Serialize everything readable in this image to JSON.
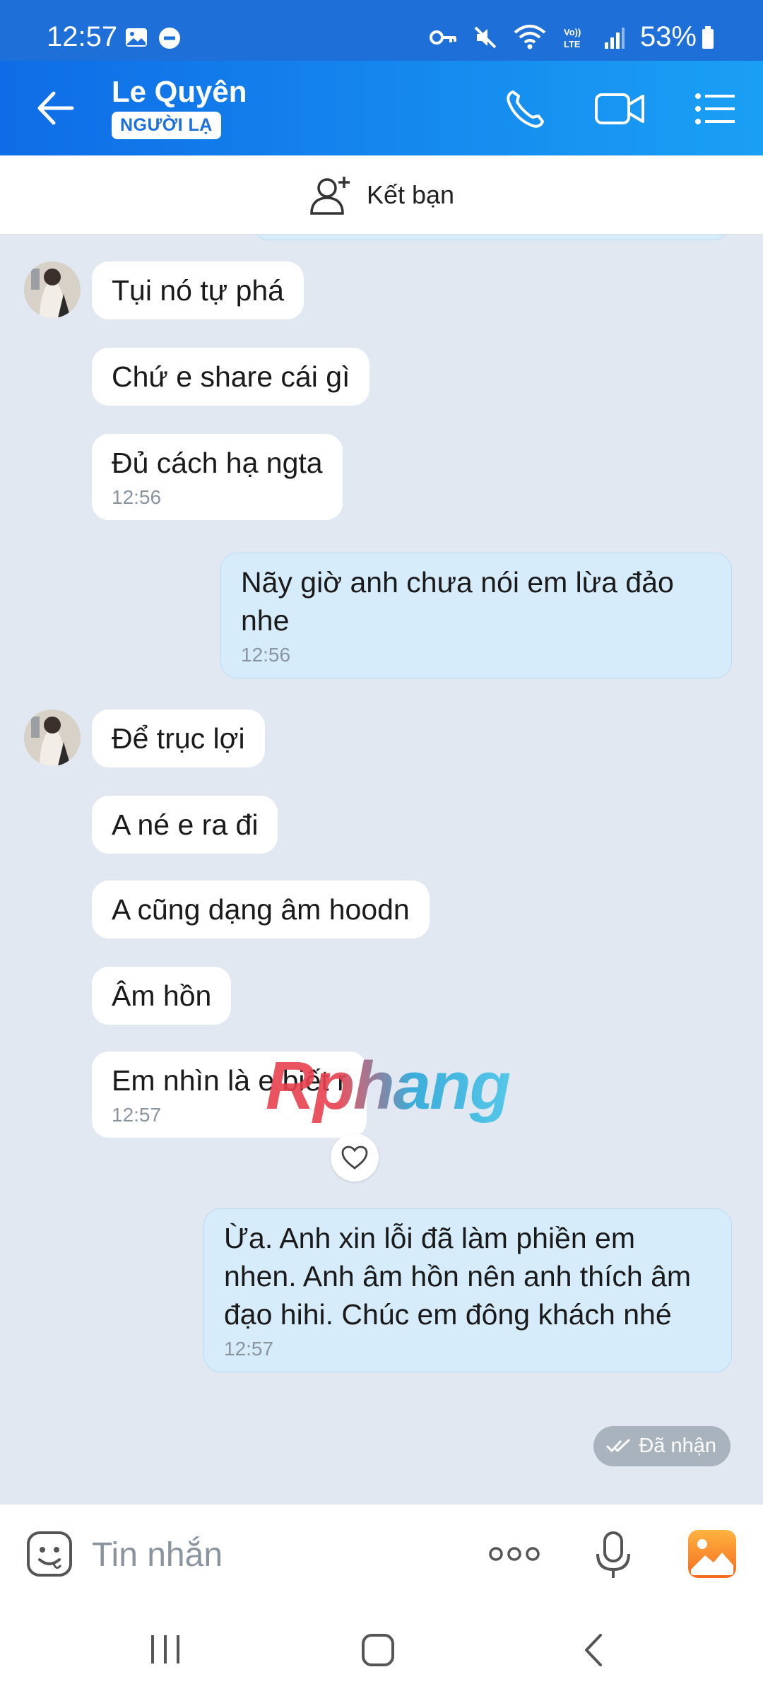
{
  "status_bar": {
    "time": "12:57",
    "battery": "53%",
    "icons": [
      "gallery-icon",
      "dnd-icon",
      "key-icon",
      "mute-icon",
      "wifi-icon",
      "volte-icon",
      "signal-icon",
      "battery-icon"
    ]
  },
  "header": {
    "contact_name": "Le Quyên",
    "badge": "NGƯỜI LẠ",
    "actions": [
      "phone-call-icon",
      "video-call-icon",
      "menu-icon"
    ]
  },
  "friend_bar": {
    "label": "Kết bạn"
  },
  "messages": {
    "m1": "Tụi nó tự phá",
    "m2": "Chứ e share cái gì",
    "m3": "Đủ cách hạ ngta",
    "m3_time": "12:56",
    "m4": "Nãy giờ anh chưa nói em lừa đảo nhe",
    "m4_time": "12:56",
    "m5": "Để trục lợi",
    "m6": "A né e ra đi",
    "m7": "A cũng dạng âm hoodn",
    "m8": "Âm hồn",
    "m9": "Em nhìn là e biết r",
    "m9_time": "12:57",
    "m10": "Ừa. Anh xin lỗi đã làm phiền em nhen. Anh âm hồn nên anh thích âm đạo hihi. Chúc em đông khách nhé",
    "m10_time": "12:57",
    "received_status": "Đã nhận"
  },
  "watermark": "Rphang",
  "input": {
    "placeholder": "Tin nhắn"
  },
  "colors": {
    "header_start": "#0f6ce6",
    "header_end": "#1aa0f5",
    "chat_bg": "#e2e8f1",
    "outgoing_bubble": "#d6ecfb",
    "incoming_bubble": "#ffffff"
  }
}
